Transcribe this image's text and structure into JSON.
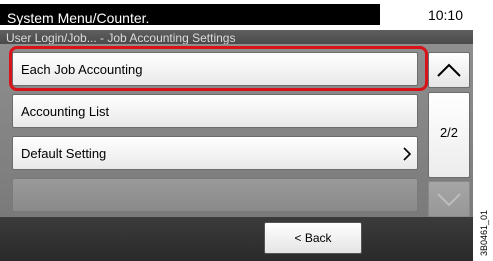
{
  "header": {
    "title": "System Menu/Counter.",
    "time": "10:10"
  },
  "breadcrumb": "User Login/Job... - Job Accounting Settings",
  "list": {
    "items": [
      {
        "label": "Each Job Accounting",
        "selected": true
      },
      {
        "label": "Accounting List"
      },
      {
        "label": "Default Setting",
        "has_chevron": true
      },
      {
        "label": ""
      }
    ]
  },
  "scroll": {
    "page_indicator": "2/2",
    "up_icon": "chevron-up-icon",
    "down_icon": "chevron-down-icon",
    "down_enabled": false
  },
  "footer": {
    "back_label": "< Back"
  },
  "figure_id": "3B0461_01",
  "colors": {
    "highlight": "#d8141a",
    "title_bar": "#000000",
    "panel_gray": "#808080"
  }
}
